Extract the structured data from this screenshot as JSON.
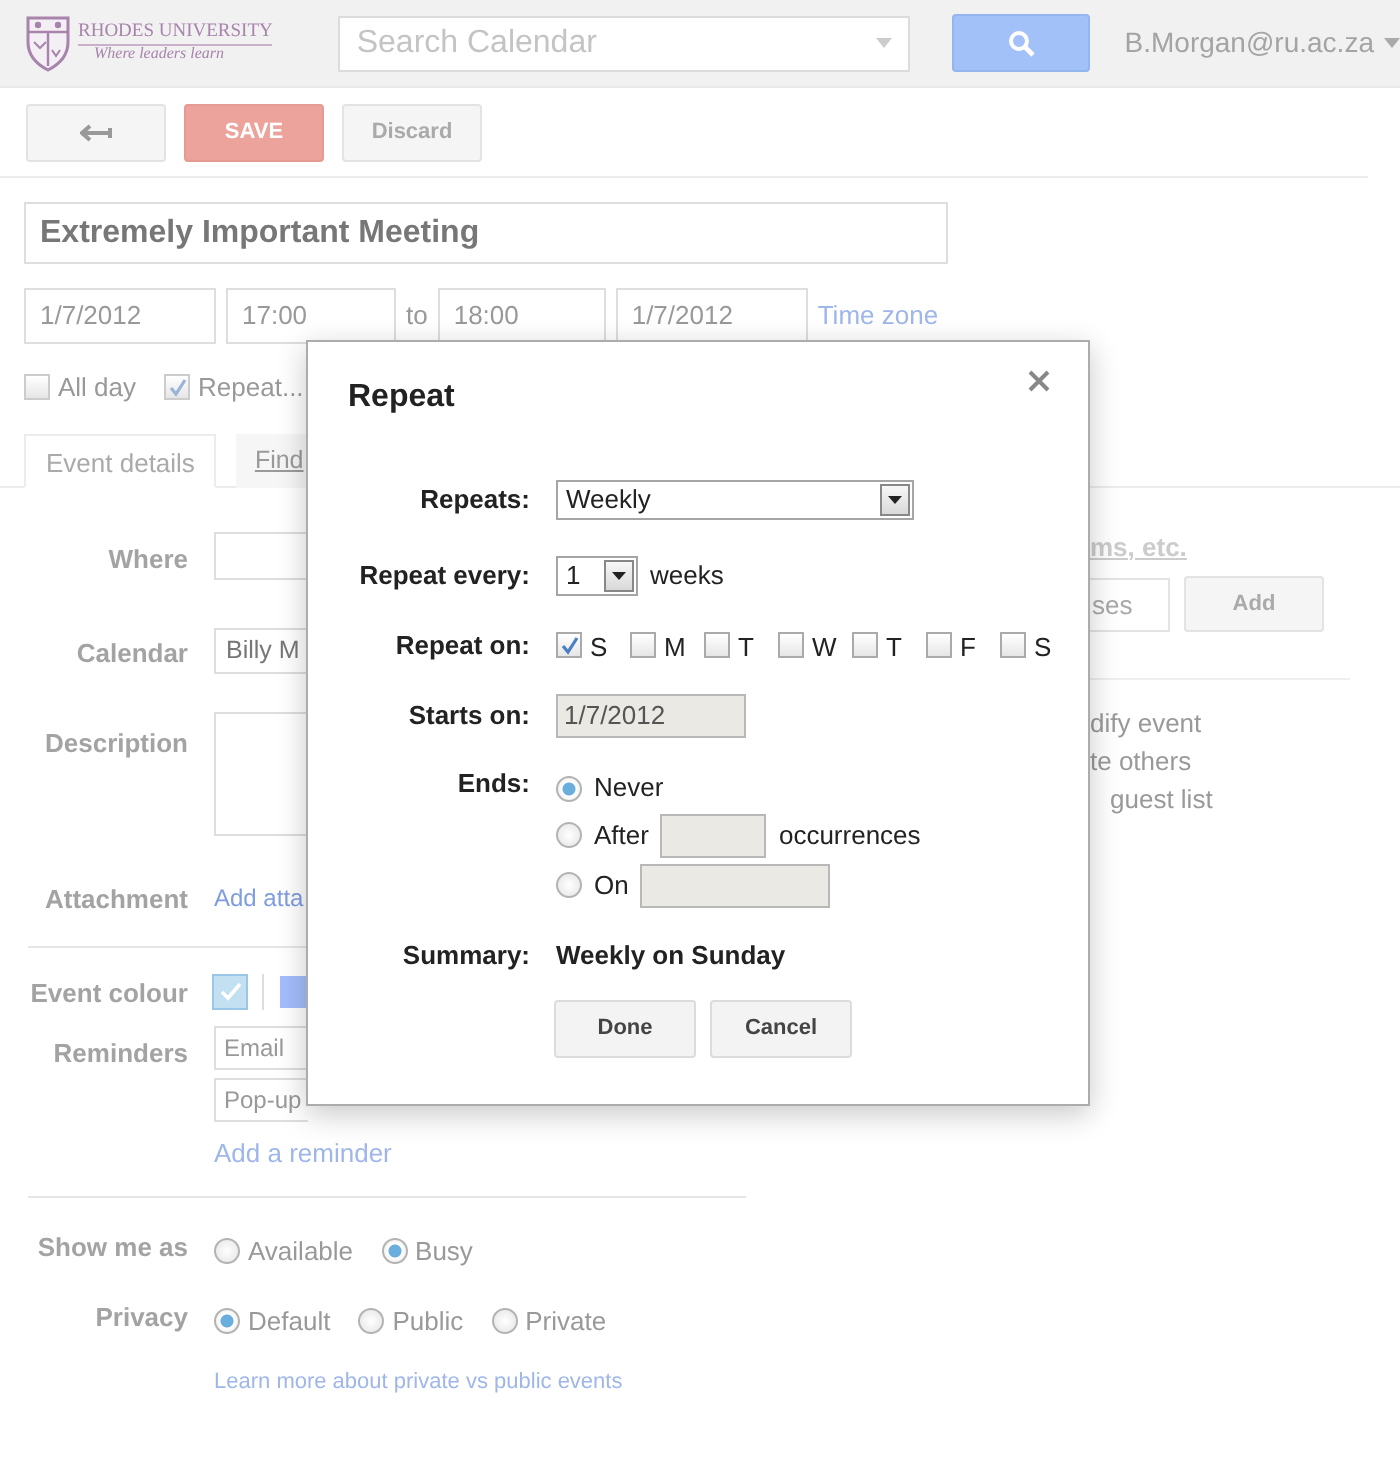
{
  "header": {
    "logo": {
      "name": "RHODES UNIVERSITY",
      "tagline": "Where leaders learn"
    },
    "search": {
      "placeholder": "Search Calendar"
    },
    "account": "B.Morgan@ru.ac.za"
  },
  "toolbar": {
    "save": "SAVE",
    "discard": "Discard"
  },
  "event": {
    "title": "Extremely Important Meeting",
    "start_date": "1/7/2012",
    "start_time": "17:00",
    "separator": "to",
    "end_time": "18:00",
    "end_date": "1/7/2012",
    "time_zone": "Time zone",
    "options": [
      {
        "label": "All day",
        "checked": false
      },
      {
        "label": "Repeat...",
        "checked": true
      }
    ]
  },
  "tabs": [
    {
      "label": "Event details",
      "selected": true
    },
    {
      "label": "Find",
      "selected": false
    }
  ],
  "details": {
    "where": {
      "label": "Where"
    },
    "calendar": {
      "label": "Calendar",
      "value": "Billy M"
    },
    "description": {
      "label": "Description"
    },
    "attachment": {
      "label": "Attachment",
      "link": "Add atta"
    },
    "event_colour": {
      "label": "Event colour",
      "swatches": [
        {
          "color": "#c3dff2",
          "selected": true
        },
        {
          "color": "#a4bdfc",
          "selected": false
        }
      ]
    },
    "reminders": {
      "label": "Reminders",
      "items": [
        "Email",
        "Pop-up"
      ],
      "add": "Add a reminder"
    },
    "show_me_as": {
      "label": "Show me as",
      "options": [
        {
          "label": "Available",
          "selected": false
        },
        {
          "label": "Busy",
          "selected": true
        }
      ]
    },
    "privacy": {
      "label": "Privacy",
      "options": [
        {
          "label": "Default",
          "selected": true
        },
        {
          "label": "Public",
          "selected": false
        },
        {
          "label": "Private",
          "selected": false
        }
      ]
    },
    "learn_more": "Learn more about private vs public events"
  },
  "guests": {
    "heading": "ms, etc.",
    "input_placeholder": "ses",
    "add_button": "Add",
    "permissions": [
      "dify event",
      "te others",
      "guest list"
    ]
  },
  "dialog": {
    "title": "Repeat",
    "repeats": {
      "label": "Repeats:",
      "value": "Weekly"
    },
    "repeat_every": {
      "label": "Repeat every:",
      "value": "1",
      "unit": "weeks"
    },
    "repeat_on": {
      "label": "Repeat on:",
      "days": [
        {
          "label": "S",
          "checked": true
        },
        {
          "label": "M",
          "checked": false
        },
        {
          "label": "T",
          "checked": false
        },
        {
          "label": "W",
          "checked": false
        },
        {
          "label": "T",
          "checked": false
        },
        {
          "label": "F",
          "checked": false
        },
        {
          "label": "S",
          "checked": false
        }
      ]
    },
    "starts_on": {
      "label": "Starts on:",
      "value": "1/7/2012"
    },
    "ends": {
      "label": "Ends:",
      "options": [
        {
          "kind": "never",
          "label": "Never",
          "selected": true
        },
        {
          "kind": "after",
          "label": "After",
          "suffix": "occurrences",
          "selected": false
        },
        {
          "kind": "on",
          "label": "On",
          "selected": false
        }
      ]
    },
    "summary": {
      "label": "Summary:",
      "value": "Weekly on Sunday"
    },
    "buttons": [
      "Done",
      "Cancel"
    ]
  }
}
